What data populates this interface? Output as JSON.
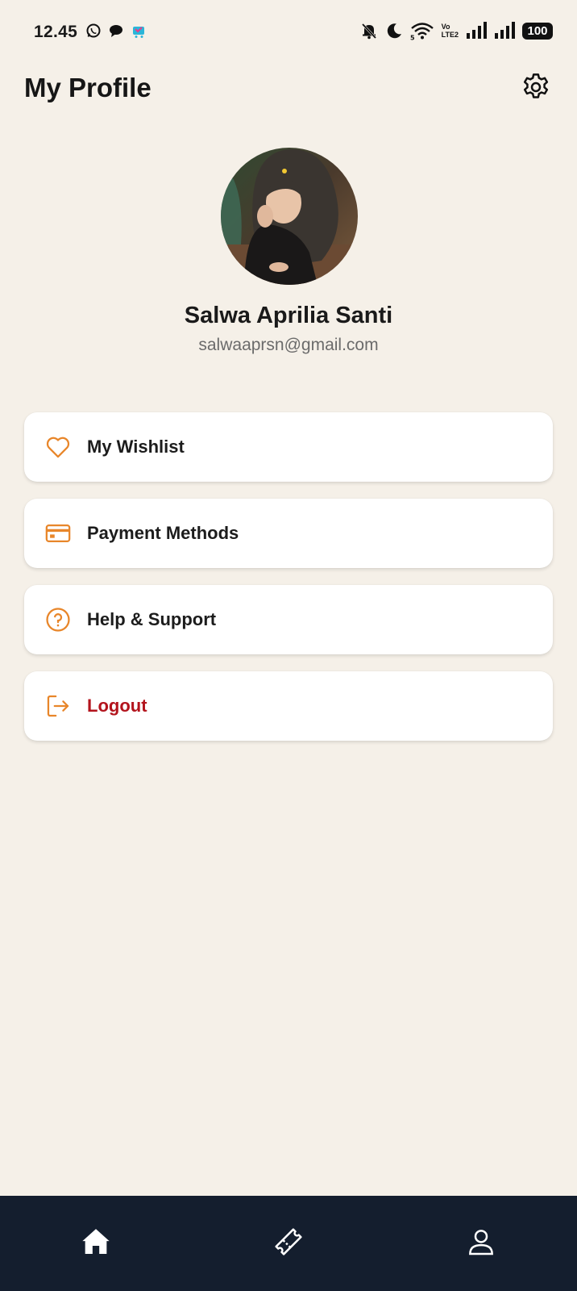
{
  "status_bar": {
    "time": "12.45",
    "left_icons": [
      "whatsapp-icon",
      "chat-bubble-icon",
      "shopping-app-icon"
    ],
    "right_icons": [
      "bell-muted-icon",
      "moon-icon",
      "wifi-5g-icon",
      "volte-icon",
      "signal-icon",
      "signal-icon"
    ],
    "volte_top": "Vo",
    "volte_bottom": "LTE2",
    "battery": "100"
  },
  "header": {
    "title": "My Profile",
    "settings_icon": "gear-icon"
  },
  "profile": {
    "name": "Salwa Aprilia Santi",
    "email": "salwaaprsn@gmail.com"
  },
  "menu": {
    "items": [
      {
        "label": "My Wishlist",
        "icon": "heart-icon"
      },
      {
        "label": "Payment Methods",
        "icon": "credit-card-icon"
      },
      {
        "label": "Help & Support",
        "icon": "question-circle-icon"
      },
      {
        "label": "Logout",
        "icon": "logout-icon"
      }
    ]
  },
  "bottom_nav": {
    "items": [
      {
        "icon": "home-icon",
        "active": true
      },
      {
        "icon": "ticket-icon",
        "active": false
      },
      {
        "icon": "user-icon",
        "active": false
      }
    ]
  },
  "colors": {
    "background": "#f5f0e8",
    "accent": "#e8862a",
    "logout": "#b3141d",
    "nav_background": "#141e2e",
    "card": "#ffffff"
  }
}
